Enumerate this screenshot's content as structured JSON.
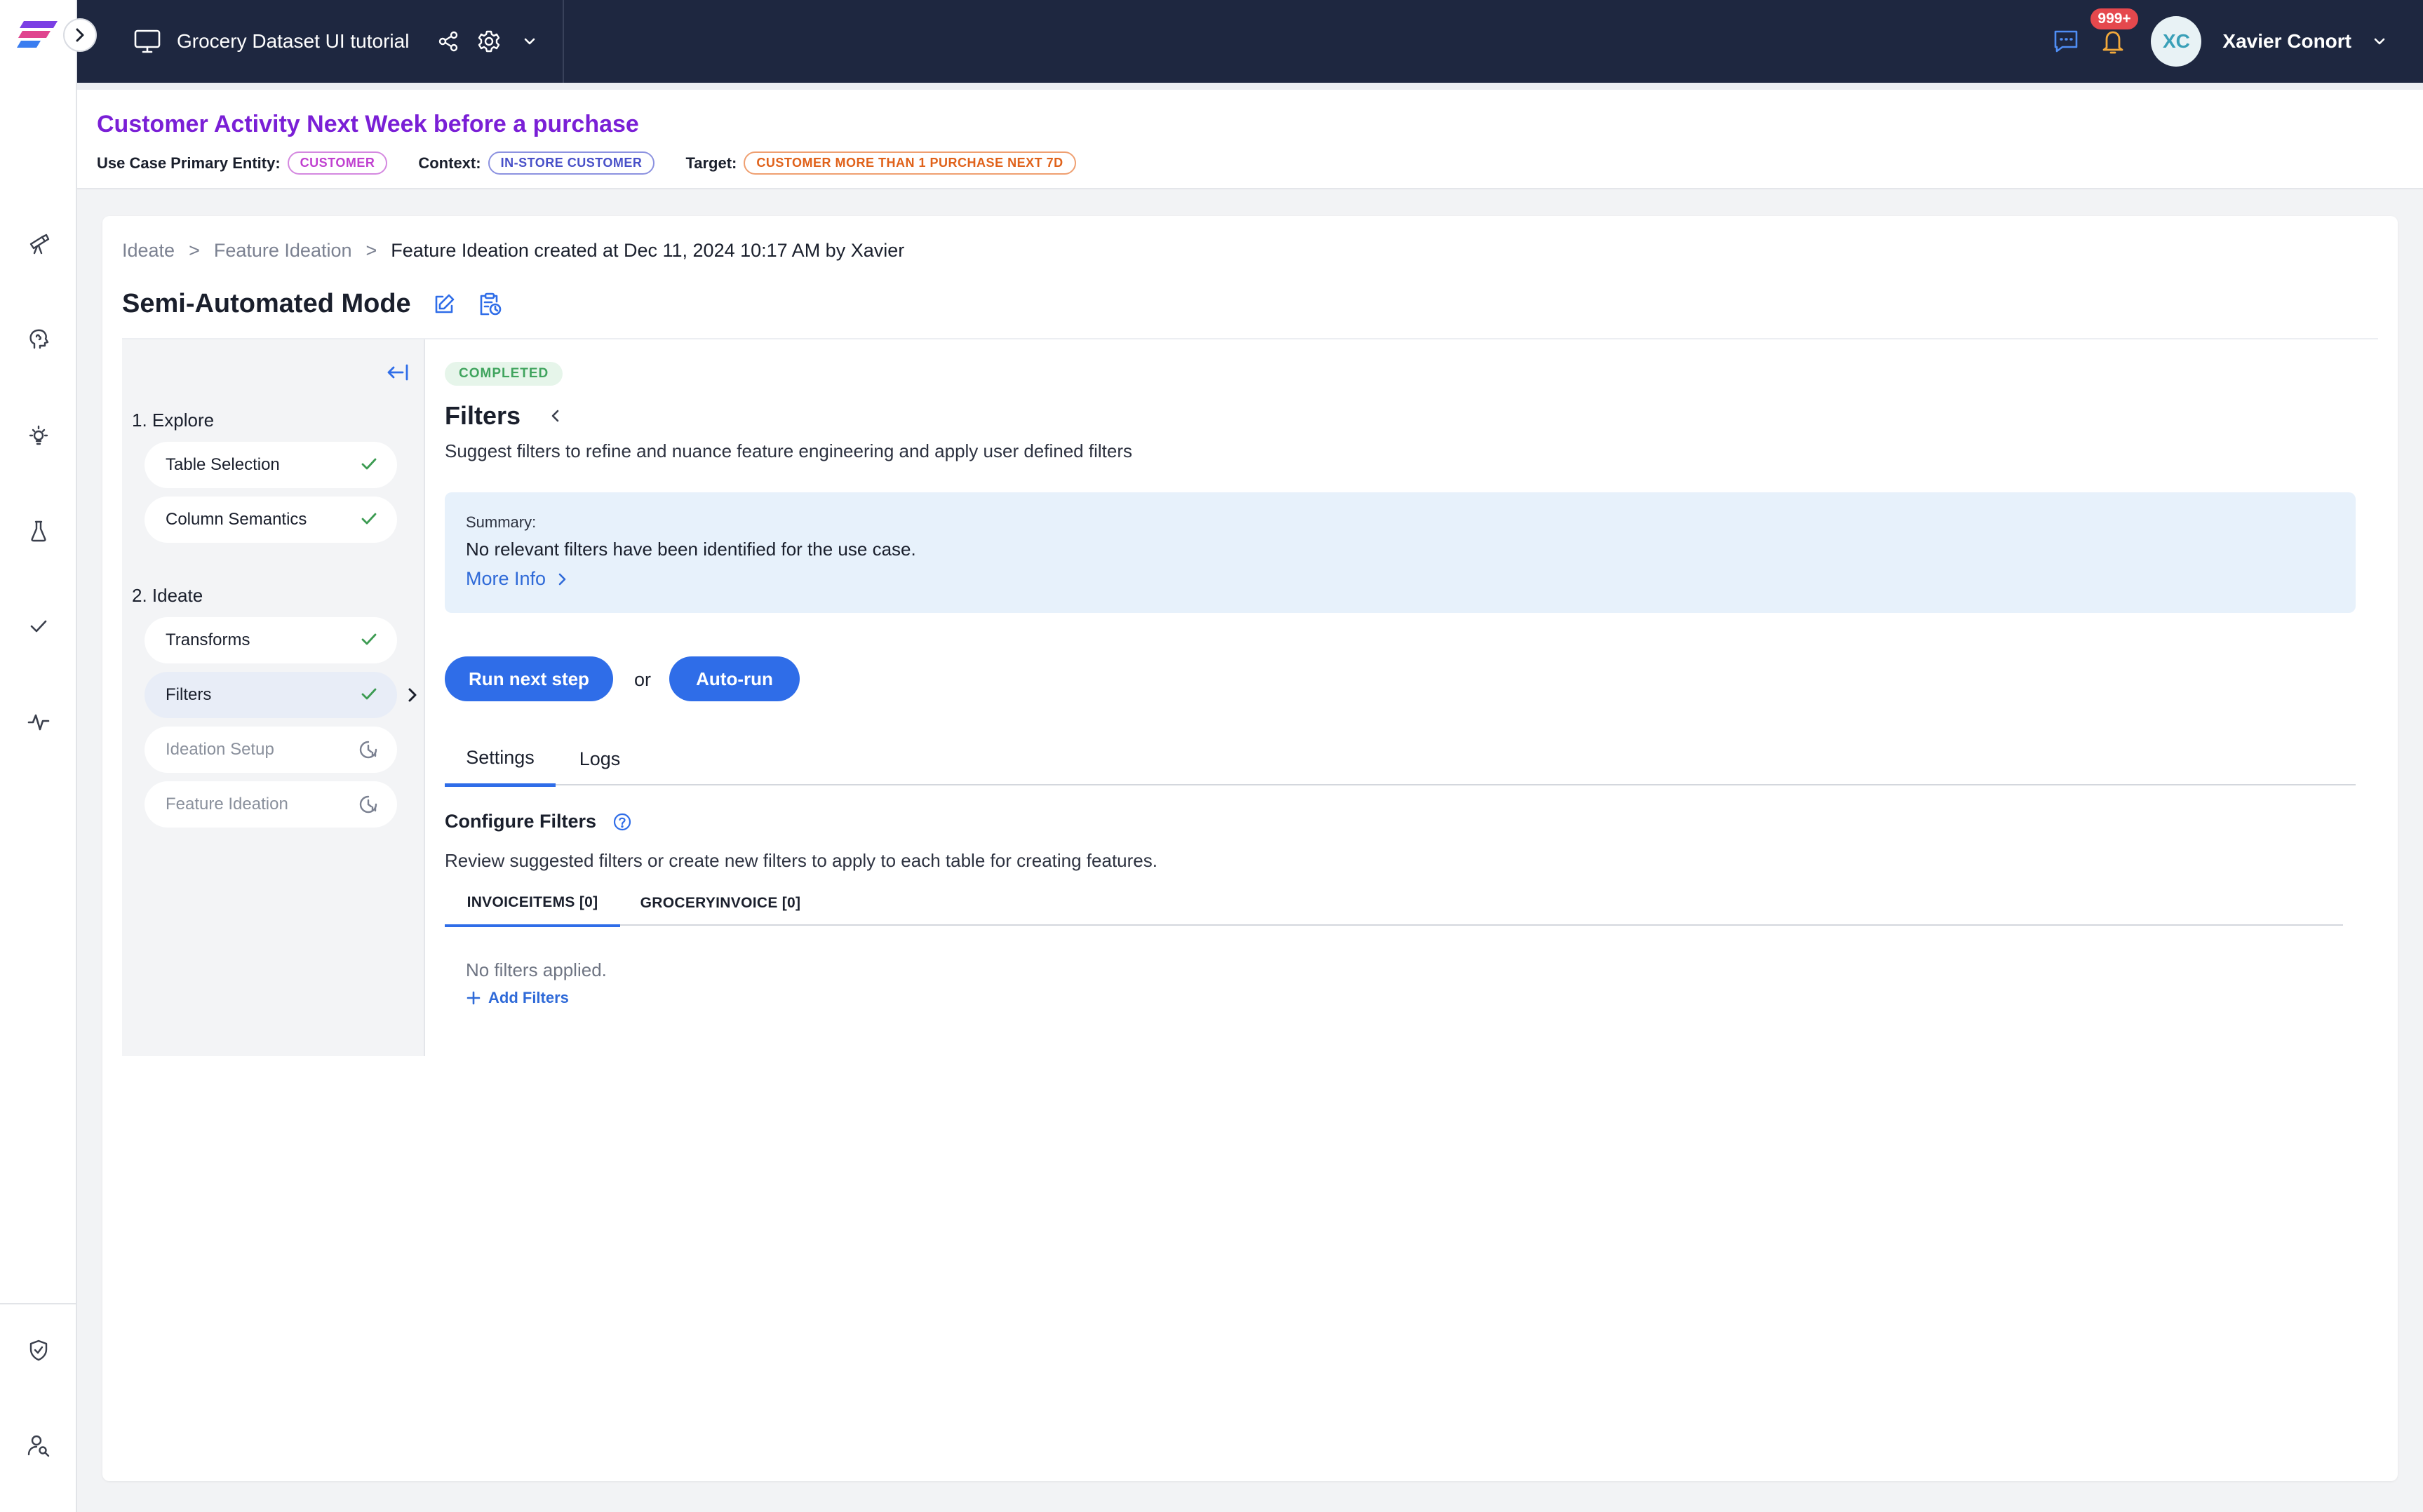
{
  "topbar": {
    "project_title": "Grocery Dataset UI tutorial",
    "notification_count": "999+",
    "avatar_initials": "XC",
    "user_name": "Xavier Conort"
  },
  "use_case": {
    "title": "Customer Activity Next Week before a purchase",
    "primary_entity_label": "Use Case Primary Entity:",
    "primary_entity": "CUSTOMER",
    "context_label": "Context:",
    "context": "IN-STORE CUSTOMER",
    "target_label": "Target:",
    "target": "CUSTOMER MORE THAN 1 PURCHASE NEXT 7D"
  },
  "breadcrumb": {
    "items": [
      "Ideate",
      "Feature Ideation"
    ],
    "separator": ">",
    "current": "Feature Ideation created at Dec 11, 2024 10:17 AM by Xavier"
  },
  "mode_title": "Semi-Automated Mode",
  "steps": {
    "sections": [
      {
        "title": "1. Explore",
        "items": [
          {
            "label": "Table Selection",
            "status": "done"
          },
          {
            "label": "Column Semantics",
            "status": "done"
          }
        ]
      },
      {
        "title": "2. Ideate",
        "items": [
          {
            "label": "Transforms",
            "status": "done"
          },
          {
            "label": "Filters",
            "status": "done",
            "active": true
          },
          {
            "label": "Ideation Setup",
            "status": "pending"
          },
          {
            "label": "Feature Ideation",
            "status": "pending"
          }
        ]
      }
    ]
  },
  "content": {
    "status_badge": "COMPLETED",
    "title": "Filters",
    "description": "Suggest filters to refine and nuance feature engineering and apply user defined filters",
    "summary": {
      "label": "Summary:",
      "text": "No relevant filters have been identified for the use case.",
      "more_info": "More Info"
    },
    "run_next_step": "Run next step",
    "or_text": "or",
    "auto_run": "Auto-run",
    "tabs": [
      "Settings",
      "Logs"
    ],
    "selected_tab": "Settings",
    "configure_title": "Configure Filters",
    "configure_desc": "Review suggested filters or create new filters to apply to each table for creating features.",
    "table_tabs": [
      "INVOICEITEMS [0]",
      "GROCERYINVOICE [0]"
    ],
    "selected_table_tab": "INVOICEITEMS [0]",
    "no_filters": "No filters applied.",
    "add_filters": "Add Filters"
  },
  "colors": {
    "topbar_bg": "#1e2740",
    "accent_blue": "#2f6de8",
    "title_purple": "#7a1fd6",
    "success_green": "#40a45e",
    "notification_red": "#e5484d"
  }
}
